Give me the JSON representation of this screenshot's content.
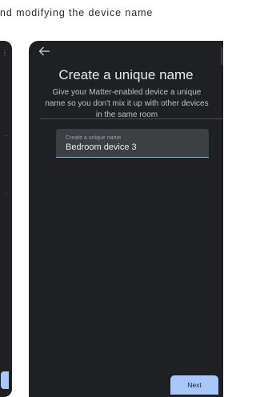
{
  "caption": "nd modifying the device name",
  "screen": {
    "title": "Create a unique name",
    "subtitle": "Give your Matter-enabled device a unique name so you don't mix it up with other devices in the same room",
    "name_field": {
      "label": "Create a unique name",
      "value": "Bedroom device 3"
    },
    "next_label": "Next"
  },
  "icons": {
    "back": "arrow-back-icon",
    "menu": "more-vert-icon"
  },
  "colors": {
    "phone_background": "#1f2023",
    "field_background": "#3c4043",
    "accent": "#a8c7fa",
    "text_primary": "#e8eaed",
    "text_secondary": "#bdc1c6"
  }
}
